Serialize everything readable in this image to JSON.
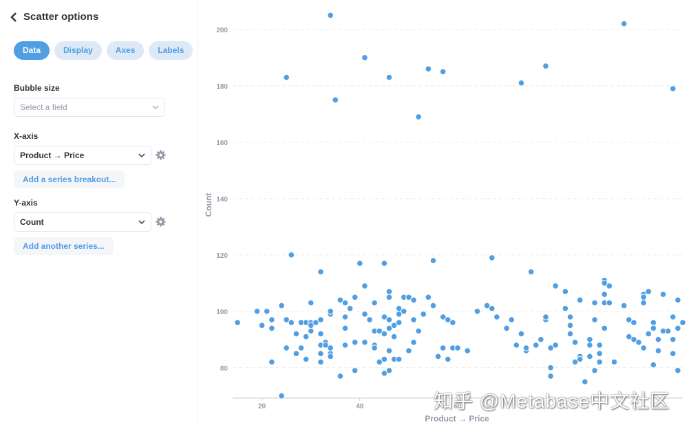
{
  "header": {
    "title": "Scatter options"
  },
  "tabs": [
    {
      "label": "Data",
      "active": true
    },
    {
      "label": "Display",
      "active": false
    },
    {
      "label": "Axes",
      "active": false
    },
    {
      "label": "Labels",
      "active": false
    }
  ],
  "bubble": {
    "label": "Bubble size",
    "placeholder": "Select a field"
  },
  "xaxis": {
    "label": "X-axis",
    "value": "Product → Price",
    "add_label": "Add a series breakout..."
  },
  "yaxis": {
    "label": "Y-axis",
    "value": "Count",
    "add_label": "Add another series..."
  },
  "colors": {
    "accent": "#509ee3",
    "point": "#509ee3"
  },
  "watermark": "知乎 @Metabase中文社区",
  "chart_data": {
    "type": "scatter",
    "xlabel": "Product → Price",
    "ylabel": "Count",
    "xlim": [
      14,
      106
    ],
    "ylim": [
      68,
      208
    ],
    "xticks": [
      20,
      40,
      60
    ],
    "yticks": [
      80,
      100,
      120,
      140,
      160,
      180,
      200
    ],
    "grid": true,
    "points": [
      [
        15,
        96
      ],
      [
        19,
        100
      ],
      [
        20,
        95
      ],
      [
        21,
        100
      ],
      [
        22,
        97
      ],
      [
        22,
        94
      ],
      [
        22,
        82
      ],
      [
        24,
        70
      ],
      [
        24,
        102
      ],
      [
        25,
        183
      ],
      [
        25,
        97
      ],
      [
        25,
        87
      ],
      [
        26,
        120
      ],
      [
        26,
        96
      ],
      [
        27,
        92
      ],
      [
        27,
        85
      ],
      [
        28,
        96
      ],
      [
        28,
        87
      ],
      [
        29,
        96
      ],
      [
        29,
        91
      ],
      [
        29,
        83
      ],
      [
        30,
        103
      ],
      [
        30,
        96
      ],
      [
        30,
        93
      ],
      [
        30,
        95
      ],
      [
        31,
        96
      ],
      [
        32,
        97
      ],
      [
        32,
        92
      ],
      [
        32,
        82
      ],
      [
        32,
        85
      ],
      [
        32,
        88
      ],
      [
        32,
        114
      ],
      [
        33,
        89
      ],
      [
        33,
        88
      ],
      [
        34,
        205
      ],
      [
        34,
        85
      ],
      [
        34,
        87
      ],
      [
        34,
        99
      ],
      [
        34,
        84
      ],
      [
        34,
        100
      ],
      [
        35,
        175
      ],
      [
        36,
        104
      ],
      [
        36,
        77
      ],
      [
        37,
        103
      ],
      [
        37,
        98
      ],
      [
        37,
        94
      ],
      [
        37,
        88
      ],
      [
        38,
        101
      ],
      [
        39,
        105
      ],
      [
        39,
        89
      ],
      [
        39,
        79
      ],
      [
        40,
        117
      ],
      [
        41,
        190
      ],
      [
        41,
        109
      ],
      [
        41,
        99
      ],
      [
        41,
        89
      ],
      [
        42,
        97
      ],
      [
        43,
        103
      ],
      [
        43,
        93
      ],
      [
        43,
        88
      ],
      [
        43,
        87
      ],
      [
        44,
        93
      ],
      [
        44,
        82
      ],
      [
        45,
        117
      ],
      [
        45,
        98
      ],
      [
        45,
        78
      ],
      [
        45,
        92
      ],
      [
        45,
        83
      ],
      [
        46,
        183
      ],
      [
        46,
        107
      ],
      [
        46,
        105
      ],
      [
        46,
        97
      ],
      [
        46,
        94
      ],
      [
        46,
        86
      ],
      [
        46,
        79
      ],
      [
        47,
        95
      ],
      [
        47,
        91
      ],
      [
        47,
        83
      ],
      [
        48,
        99
      ],
      [
        48,
        101
      ],
      [
        48,
        96
      ],
      [
        48,
        83
      ],
      [
        49,
        105
      ],
      [
        49,
        100
      ],
      [
        50,
        105
      ],
      [
        50,
        86
      ],
      [
        51,
        104
      ],
      [
        51,
        97
      ],
      [
        51,
        89
      ],
      [
        52,
        169
      ],
      [
        52,
        93
      ],
      [
        53,
        99
      ],
      [
        54,
        186
      ],
      [
        54,
        105
      ],
      [
        55,
        102
      ],
      [
        55,
        118
      ],
      [
        56,
        84
      ],
      [
        57,
        185
      ],
      [
        57,
        98
      ],
      [
        57,
        87
      ],
      [
        58,
        97
      ],
      [
        58,
        83
      ],
      [
        59,
        96
      ],
      [
        59,
        87
      ],
      [
        60,
        87
      ],
      [
        62,
        86
      ],
      [
        64,
        100
      ],
      [
        66,
        102
      ],
      [
        67,
        119
      ],
      [
        67,
        101
      ],
      [
        68,
        98
      ],
      [
        70,
        94
      ],
      [
        71,
        97
      ],
      [
        72,
        88
      ],
      [
        73,
        181
      ],
      [
        73,
        92
      ],
      [
        74,
        86
      ],
      [
        74,
        87
      ],
      [
        75,
        114
      ],
      [
        76,
        88
      ],
      [
        77,
        90
      ],
      [
        78,
        187
      ],
      [
        78,
        97
      ],
      [
        78,
        98
      ],
      [
        79,
        80
      ],
      [
        79,
        77
      ],
      [
        79,
        87
      ],
      [
        80,
        109
      ],
      [
        80,
        88
      ],
      [
        82,
        107
      ],
      [
        82,
        101
      ],
      [
        83,
        98
      ],
      [
        83,
        95
      ],
      [
        83,
        92
      ],
      [
        84,
        89
      ],
      [
        84,
        82
      ],
      [
        85,
        104
      ],
      [
        85,
        104
      ],
      [
        85,
        84
      ],
      [
        85,
        83
      ],
      [
        86,
        75
      ],
      [
        87,
        90
      ],
      [
        87,
        88
      ],
      [
        87,
        84
      ],
      [
        88,
        103
      ],
      [
        88,
        97
      ],
      [
        88,
        79
      ],
      [
        89,
        85
      ],
      [
        89,
        88
      ],
      [
        89,
        82
      ],
      [
        90,
        106
      ],
      [
        90,
        94
      ],
      [
        90,
        103
      ],
      [
        90,
        111
      ],
      [
        90,
        110
      ],
      [
        91,
        109
      ],
      [
        91,
        103
      ],
      [
        92,
        82
      ],
      [
        94,
        202
      ],
      [
        94,
        102
      ],
      [
        95,
        97
      ],
      [
        95,
        91
      ],
      [
        95,
        97
      ],
      [
        96,
        96
      ],
      [
        96,
        90
      ],
      [
        97,
        89
      ],
      [
        98,
        106
      ],
      [
        98,
        105
      ],
      [
        98,
        103
      ],
      [
        98,
        87
      ],
      [
        99,
        107
      ],
      [
        99,
        92
      ],
      [
        100,
        96
      ],
      [
        100,
        94
      ],
      [
        100,
        81
      ],
      [
        101,
        86
      ],
      [
        101,
        90
      ],
      [
        102,
        93
      ],
      [
        102,
        106
      ],
      [
        103,
        93
      ],
      [
        104,
        179
      ],
      [
        104,
        90
      ],
      [
        104,
        85
      ],
      [
        104,
        98
      ],
      [
        105,
        94
      ],
      [
        105,
        79
      ],
      [
        105,
        104
      ],
      [
        106,
        96
      ]
    ]
  }
}
